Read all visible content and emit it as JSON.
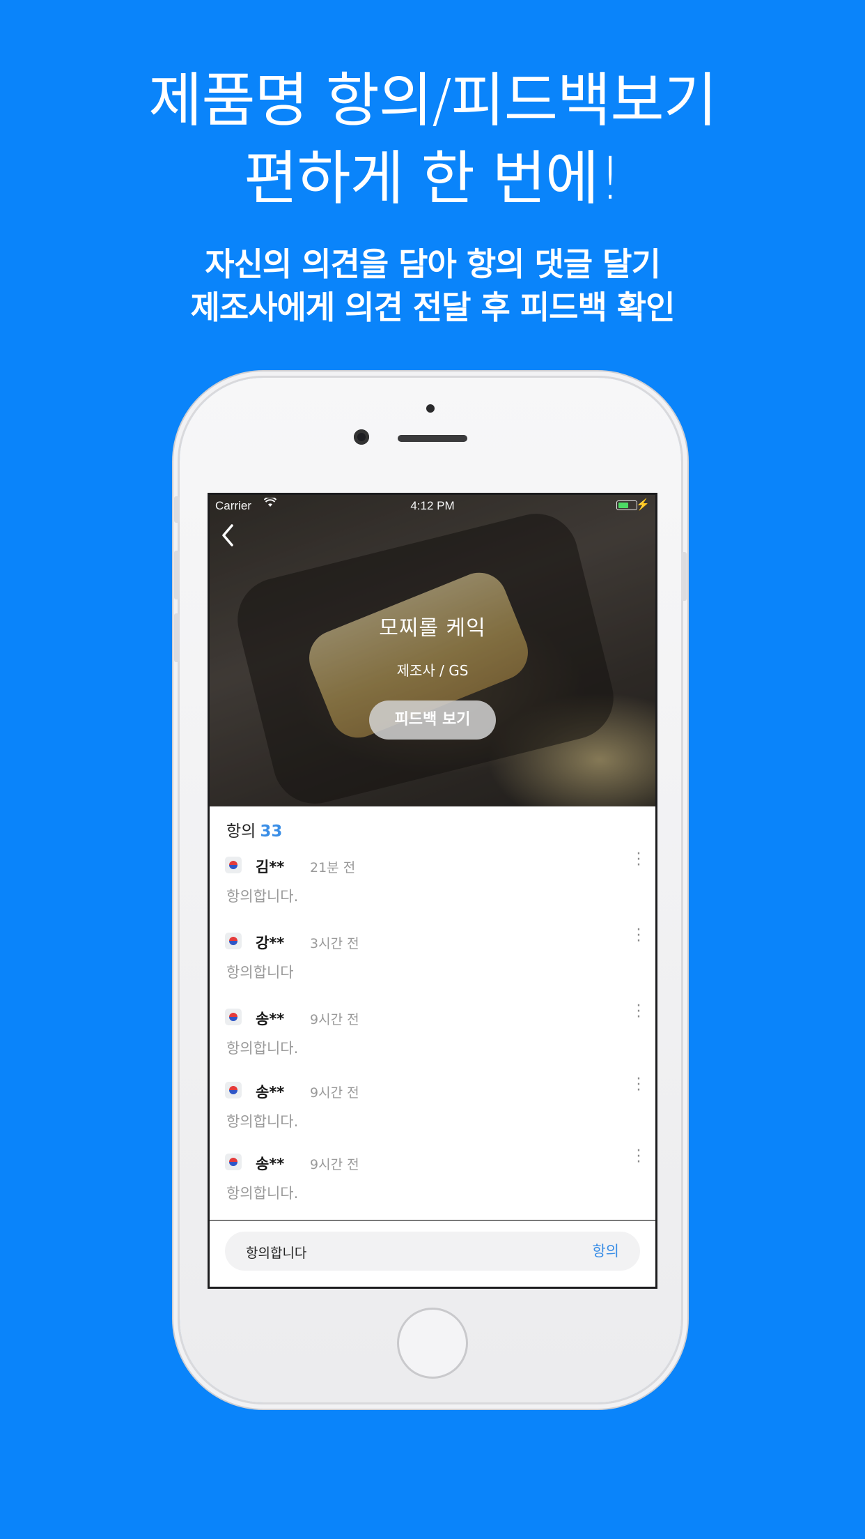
{
  "promo": {
    "headline_line1": "제품명 항의/피드백보기",
    "headline_line2": "편하게 한 번에!",
    "sub_line1": "자신의 의견을 담아 항의 댓글 달기",
    "sub_line2": "제조사에게 의견 전달 후 피드백 확인"
  },
  "statusbar": {
    "carrier": "Carrier",
    "time": "4:12 PM",
    "wifi_icon": "wifi-icon",
    "battery_icon": "battery-icon"
  },
  "product": {
    "title": "모찌롤 케익",
    "maker": "제조사 / GS",
    "feedback_button": "피드백 보기"
  },
  "comments_header": {
    "label": "항의",
    "count": "33"
  },
  "comments": [
    {
      "name": "김**",
      "time": "21분 전",
      "body": "항의합니다."
    },
    {
      "name": "강**",
      "time": "3시간 전",
      "body": "항의합니다"
    },
    {
      "name": "송**",
      "time": "9시간 전",
      "body": "항의합니다."
    },
    {
      "name": "송**",
      "time": "9시간 전",
      "body": "항의합니다."
    },
    {
      "name": "송**",
      "time": "9시간 전",
      "body": "항의합니다."
    }
  ],
  "composer": {
    "value": "항의합니다",
    "send_label": "항의"
  },
  "colors": {
    "background": "#0a84fa",
    "accent": "#3a8ee6"
  }
}
